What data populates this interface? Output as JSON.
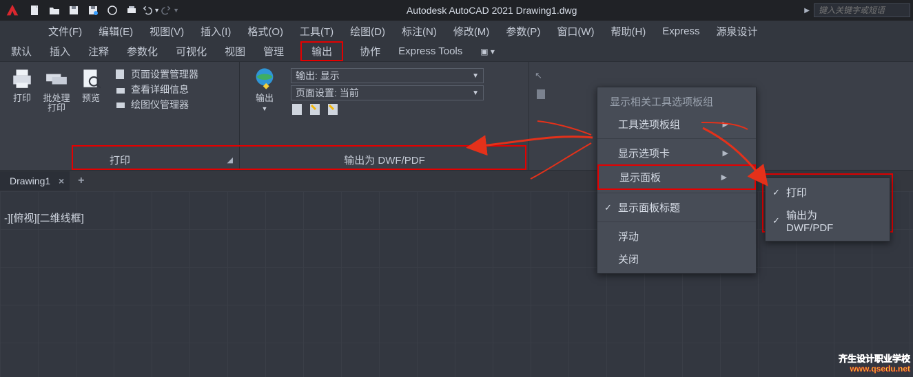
{
  "title": "Autodesk AutoCAD 2021    Drawing1.dwg",
  "search_placeholder": "键入关键字或短语",
  "menu": [
    "文件(F)",
    "编辑(E)",
    "视图(V)",
    "插入(I)",
    "格式(O)",
    "工具(T)",
    "绘图(D)",
    "标注(N)",
    "修改(M)",
    "参数(P)",
    "窗口(W)",
    "帮助(H)",
    "Express",
    "源泉设计"
  ],
  "tabs": [
    "默认",
    "插入",
    "注释",
    "参数化",
    "可视化",
    "视图",
    "管理",
    "输出",
    "协作",
    "Express Tools"
  ],
  "active_tab_index": 7,
  "panel_print": {
    "btn1": "打印",
    "btn2": "批处理\n打印",
    "btn3": "预览",
    "row1": "页面设置管理器",
    "row2": "查看详细信息",
    "row3": "绘图仪管理器",
    "title": "打印"
  },
  "panel_export": {
    "btn": "输出",
    "dd1": "输出: 显示",
    "dd2": "页面设置: 当前",
    "title": "输出为 DWF/PDF"
  },
  "filetab": "Drawing1",
  "view_label": "-][俯视][二维线框]",
  "ctx1": {
    "head": "显示相关工具选项板组",
    "i1": "工具选项板组",
    "i2": "显示选项卡",
    "i3": "显示面板",
    "i4": "显示面板标题",
    "i5": "浮动",
    "i6": "关闭"
  },
  "ctx2": {
    "i1": "打印",
    "i2": "输出为 DWF/PDF"
  },
  "watermark": {
    "l1": "齐生设计职业学校",
    "l2": "www.qsedu.net"
  }
}
